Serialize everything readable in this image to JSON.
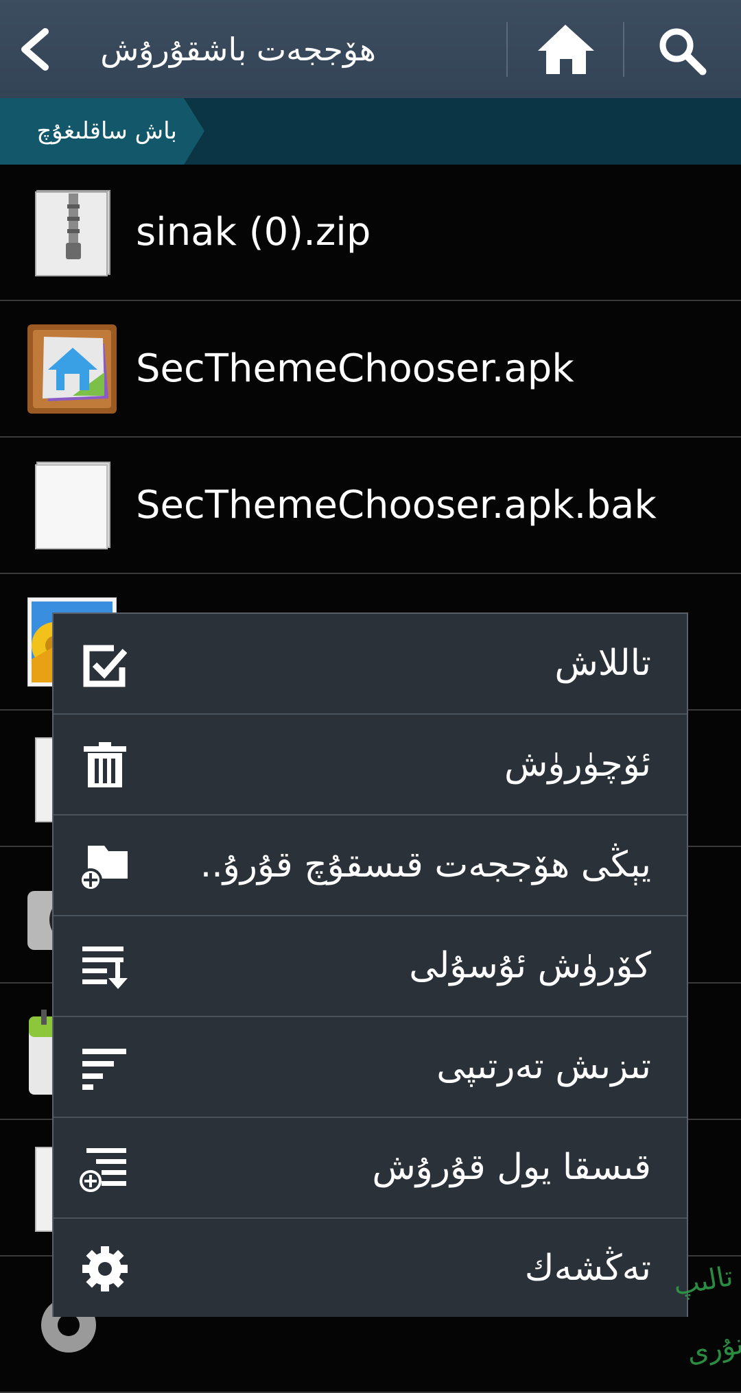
{
  "action_bar": {
    "title": "ھۆججەت باشقۇرۇش"
  },
  "breadcrumb": {
    "items": [
      "باش ساقلىغۇچ"
    ]
  },
  "files": [
    {
      "name": "sinak (0).zip",
      "icon": "zip-file-icon"
    },
    {
      "name": "SecThemeChooser.apk",
      "icon": "theme-app-icon"
    },
    {
      "name": "SecThemeChooser.apk.bak",
      "icon": "blank-file-icon"
    }
  ],
  "menu": {
    "items": [
      {
        "label": "تاللاش",
        "icon": "checkbox-icon"
      },
      {
        "label": "ئۆچۈرۈش",
        "icon": "trash-icon"
      },
      {
        "label": "يېڭى ھۆججەت قىسقۇچ قۇرۇ..",
        "icon": "new-folder-icon"
      },
      {
        "label": "كۆرۈش ئۇسۇلى",
        "icon": "view-mode-icon"
      },
      {
        "label": "تىزىش تەرتىپى",
        "icon": "sort-icon"
      },
      {
        "label": "قىسقا يول قۇرۇش",
        "icon": "add-shortcut-icon"
      },
      {
        "label": "تەڭشەك",
        "icon": "gear-icon"
      }
    ]
  },
  "watermark": {
    "text": "تالىپ نۇرى"
  },
  "colors": {
    "action_bar": "#374a5c",
    "breadcrumb_active": "#12586a",
    "breadcrumb_bg": "#0b3545",
    "menu_bg": "#2b3139",
    "list_bg": "#050505"
  }
}
